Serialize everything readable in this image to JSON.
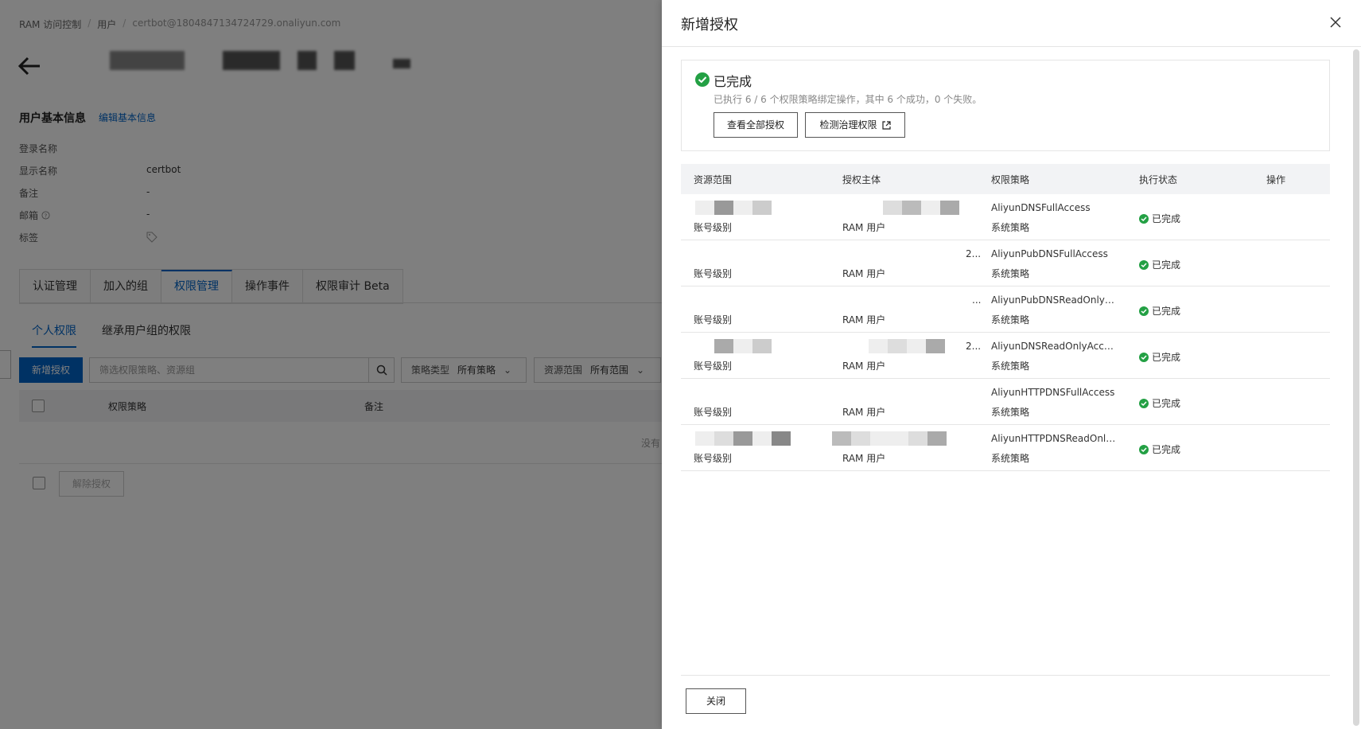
{
  "breadcrumb": {
    "root": "RAM 访问控制",
    "users": "用户",
    "current": "certbot@1804847134724729.onaliyun.com"
  },
  "user_info": {
    "section_title": "用户基本信息",
    "edit_link": "编辑基本信息",
    "rows": [
      {
        "label": "登录名称",
        "value": ""
      },
      {
        "label": "显示名称",
        "value": "certbot"
      },
      {
        "label": "备注",
        "value": "-"
      },
      {
        "label": "邮箱",
        "value": "-"
      },
      {
        "label": "标签",
        "value": ""
      }
    ]
  },
  "tabs": [
    "认证管理",
    "加入的组",
    "权限管理",
    "操作事件",
    "权限审计 Beta"
  ],
  "subtabs": [
    "个人权限",
    "继承用户组的权限"
  ],
  "toolbar": {
    "add_button": "新增授权",
    "search_placeholder": "筛选权限策略、资源组",
    "policy_type_label": "策略类型",
    "policy_type_value": "所有策略",
    "scope_label": "资源范围",
    "scope_value": "所有范围"
  },
  "bg_table": {
    "col_policy": "权限策略",
    "col_note": "备注",
    "empty": "没有",
    "revoke_button": "解除授权"
  },
  "drawer": {
    "title": "新增授权",
    "result_title": "已完成",
    "result_desc": "已执行 6 / 6 个权限策略绑定操作，其中 6 个成功，0 个失败。",
    "view_all_button": "查看全部授权",
    "check_button": "检测治理权限",
    "columns": [
      "资源范围",
      "授权主体",
      "权限策略",
      "执行状态",
      "操作"
    ],
    "rows": [
      {
        "scope": "账号级别",
        "principal": "RAM 用户",
        "principal_top": "",
        "policy": "AliyunDNSFullAccess",
        "policy_type": "系统策略",
        "status": "已完成"
      },
      {
        "scope": "账号级别",
        "principal": "RAM 用户",
        "principal_top": "2...",
        "policy": "AliyunPubDNSFullAccess",
        "policy_type": "系统策略",
        "status": "已完成"
      },
      {
        "scope": "账号级别",
        "principal": "RAM 用户",
        "principal_top": "...",
        "policy": "AliyunPubDNSReadOnlyA...",
        "policy_type": "系统策略",
        "status": "已完成"
      },
      {
        "scope": "账号级别",
        "principal": "RAM 用户",
        "principal_top": "2...",
        "policy": "AliyunDNSReadOnlyAccess",
        "policy_type": "系统策略",
        "status": "已完成"
      },
      {
        "scope": "账号级别",
        "principal": "RAM 用户",
        "principal_top": "",
        "policy": "AliyunHTTPDNSFullAccess",
        "policy_type": "系统策略",
        "status": "已完成"
      },
      {
        "scope": "账号级别",
        "principal": "RAM 用户",
        "principal_top": "",
        "policy": "AliyunHTTPDNSReadOnly...",
        "policy_type": "系统策略",
        "status": "已完成"
      }
    ],
    "close_button": "关闭"
  },
  "colors": {
    "primary": "#0064c8",
    "success": "#23a044"
  }
}
